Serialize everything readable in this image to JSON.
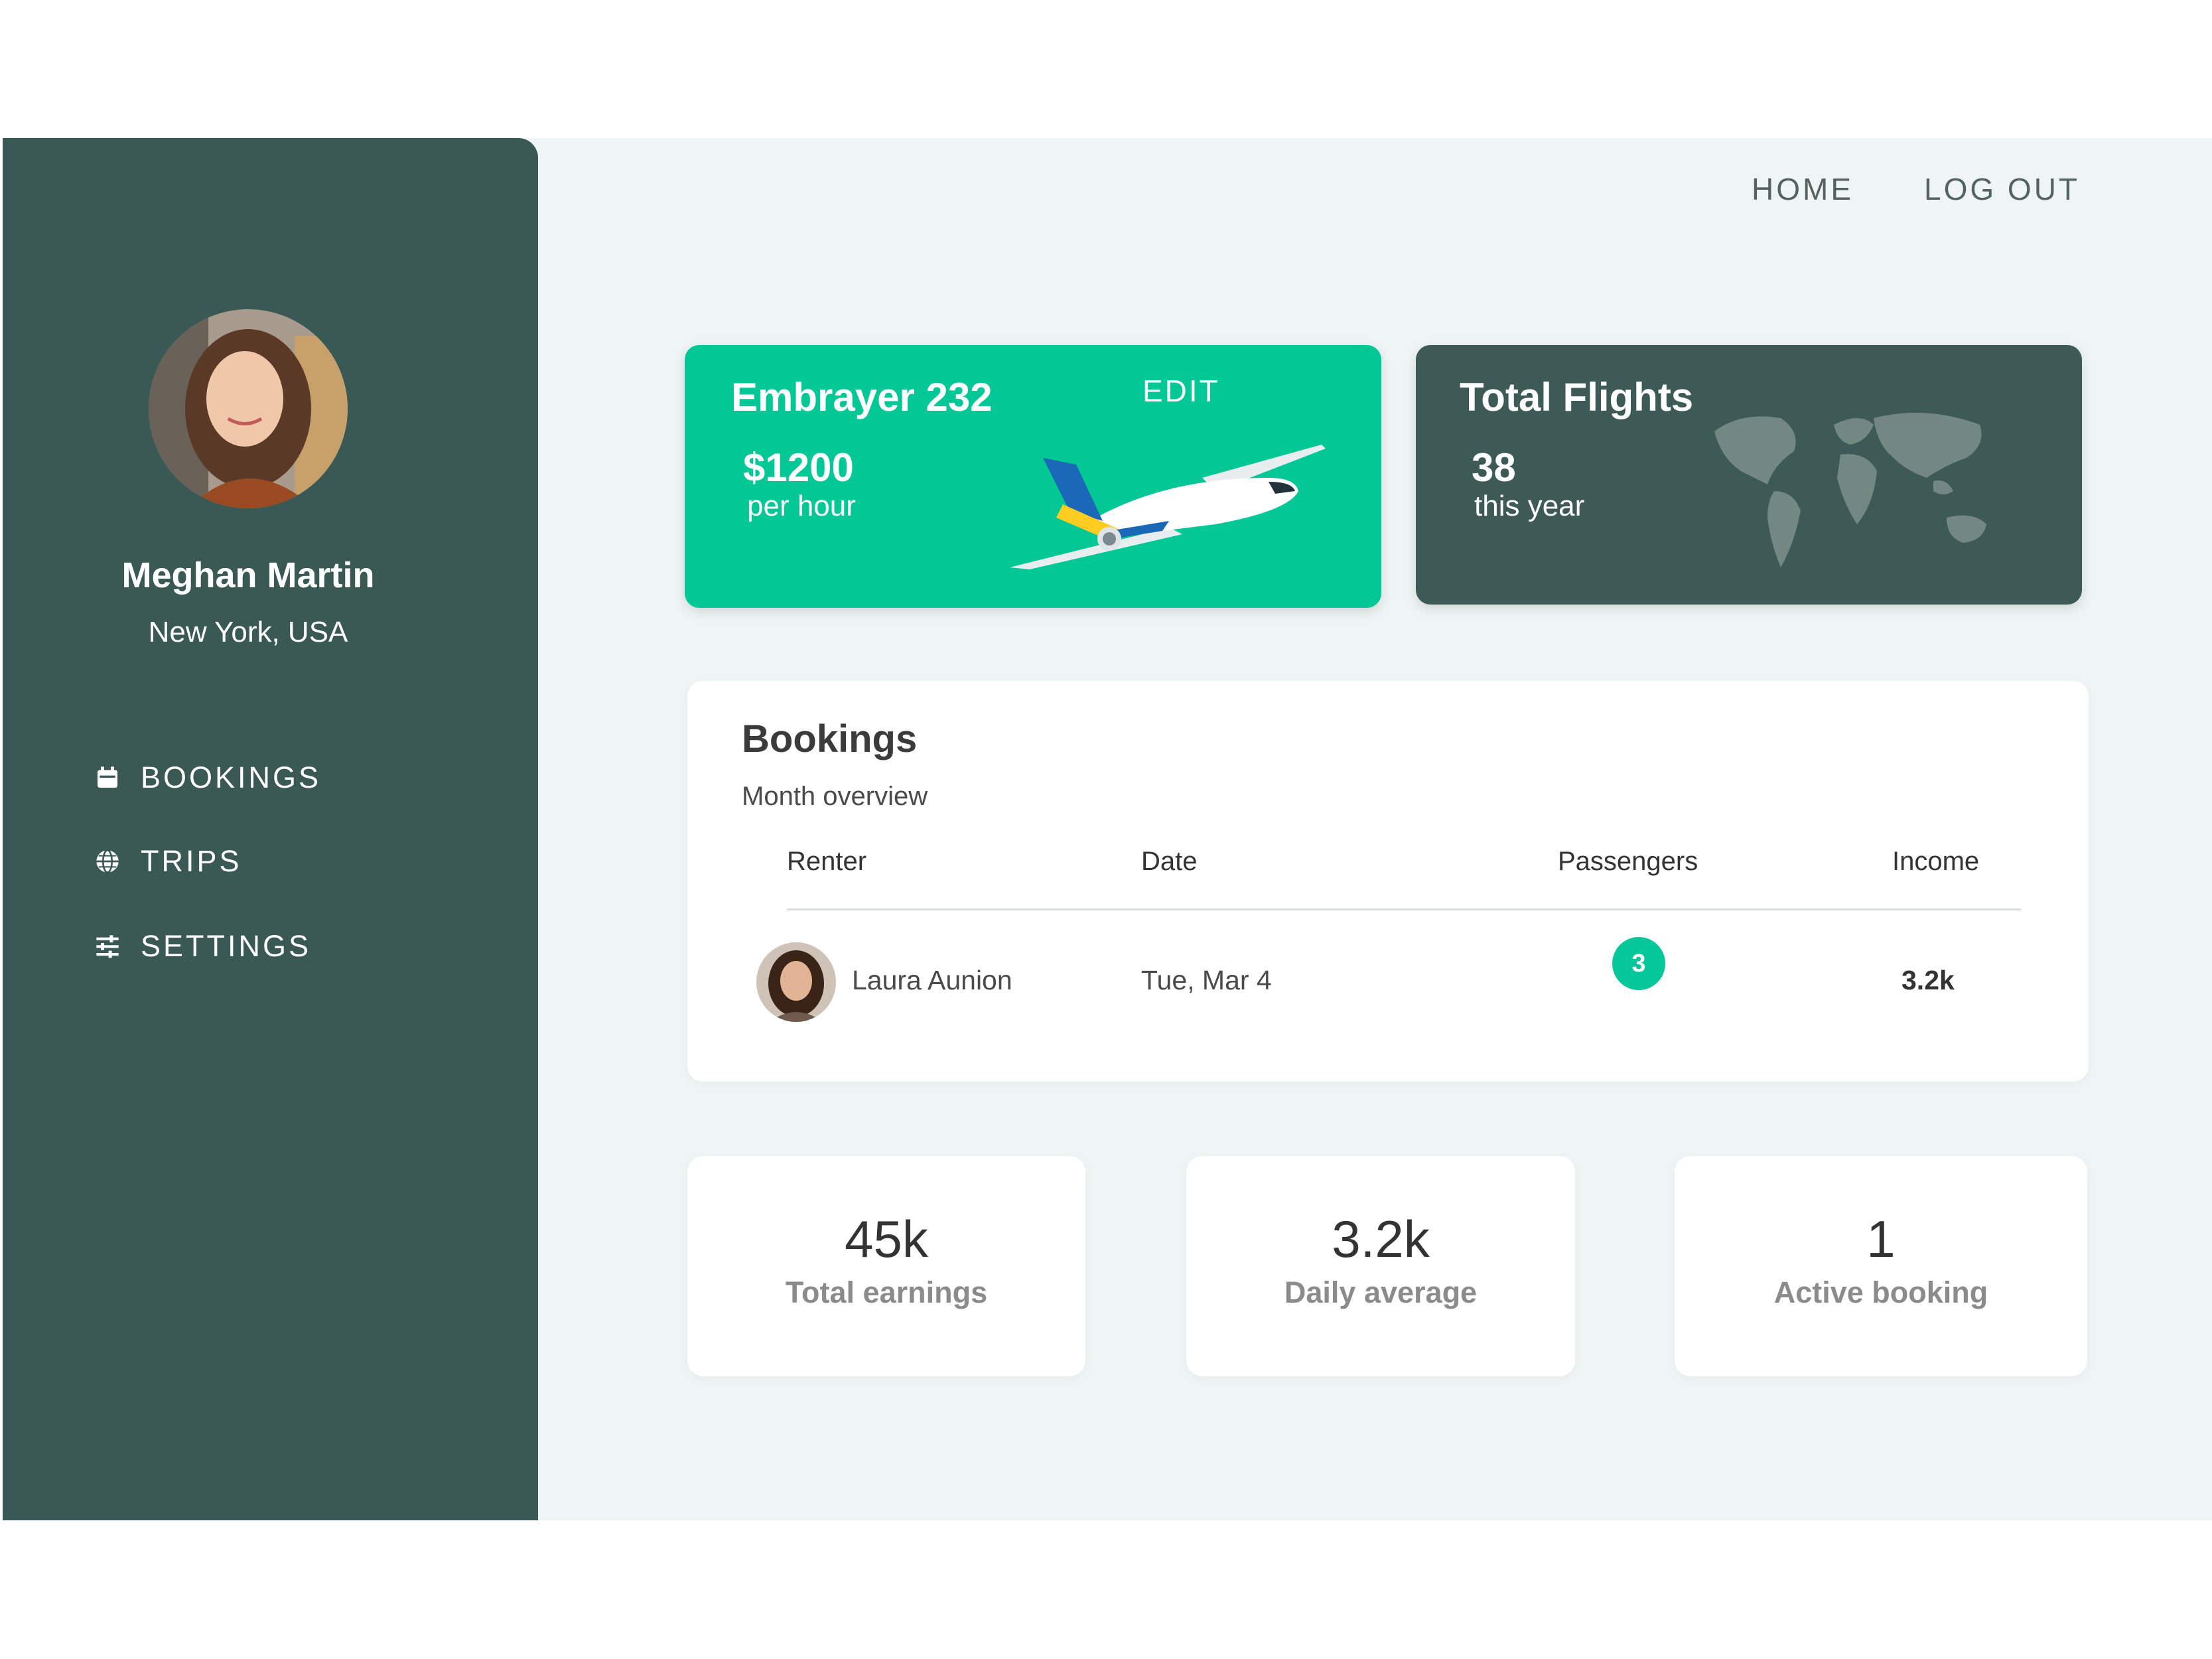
{
  "colors": {
    "sidebar": "#3a5954",
    "page_background": "#eef5f4",
    "accent_green": "#03c896",
    "dark_card": "#3d5a56",
    "badge": "#06c79a"
  },
  "profile": {
    "name": "Meghan Martin",
    "location": "New York, USA",
    "avatar_icon": "user-avatar"
  },
  "sidebar": {
    "items": [
      {
        "label": "BOOKINGS",
        "icon": "calendar-icon"
      },
      {
        "label": "TRIPS",
        "icon": "globe-icon"
      },
      {
        "label": "SETTINGS",
        "icon": "sliders-icon"
      }
    ]
  },
  "topnav": {
    "home": "HOME",
    "logout": "LOG OUT"
  },
  "aircraft_card": {
    "title": "Embrayer 232",
    "edit_label": "EDIT",
    "price": "$1200",
    "price_unit": "per hour",
    "image_icon": "airplane-icon"
  },
  "flights_card": {
    "title": "Total Flights",
    "count": "38",
    "period": "this year",
    "image_icon": "world-map-icon"
  },
  "bookings": {
    "title": "Bookings",
    "subtitle": "Month overview",
    "columns": [
      "Renter",
      "Date",
      "Passengers",
      "Income"
    ],
    "rows": [
      {
        "renter": "Laura Aunion",
        "date": "Tue, Mar 4",
        "passengers": "3",
        "income": "3.2k"
      }
    ]
  },
  "stats": [
    {
      "value": "45k",
      "label": "Total earnings"
    },
    {
      "value": "3.2k",
      "label": "Daily average"
    },
    {
      "value": "1",
      "label": "Active booking"
    }
  ]
}
